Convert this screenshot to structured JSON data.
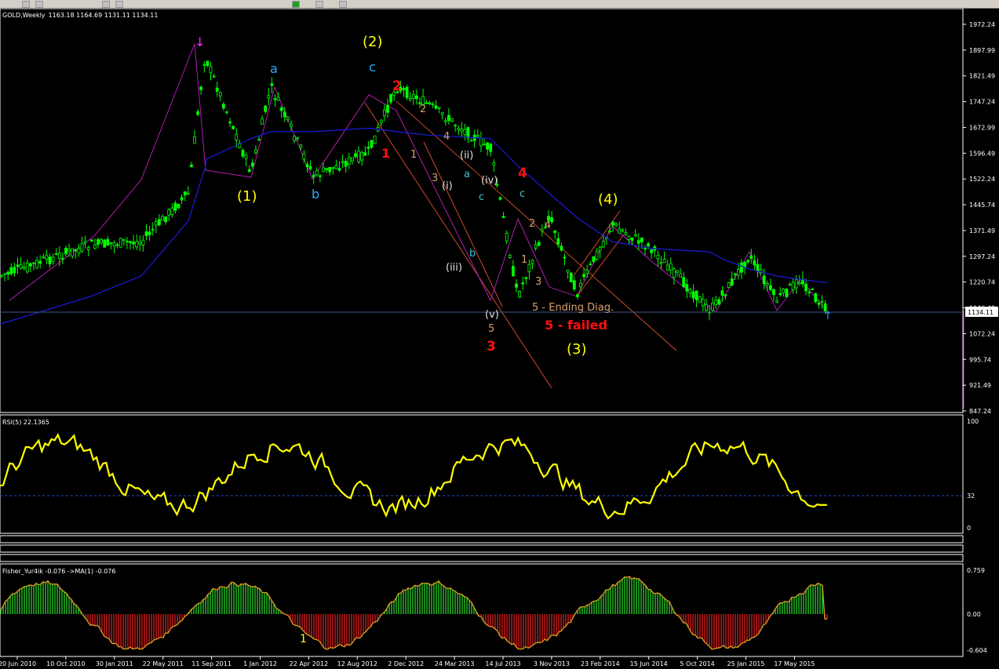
{
  "window": {
    "symbol_header": "GOLD,Weekly",
    "ohlc": "1163.18 1164.69 1131.11 1134.11"
  },
  "colors": {
    "background": "#000000",
    "candle": "#00ff00",
    "ma": "#1a1acc",
    "rsi": "#ffff00",
    "fisher_pos": "#2bd12b",
    "fisher_neg": "#e02020",
    "fisher_line": "#e0a020",
    "current_price_line": "#3b5a8a",
    "channel": "#e05030",
    "zigzag": "#c020c0",
    "wave_yellow": "#ffff00",
    "wave_cyan": "#20b0ff",
    "wave_red": "#ff1010",
    "wave_orange": "#d8a070",
    "wave_white": "#e0e0e0",
    "wave_teal": "#40c0d0"
  },
  "price_axis": {
    "labels": [
      "1972.24",
      "1897.99",
      "1821.49",
      "1747.24",
      "1672.99",
      "1596.49",
      "1522.24",
      "1445.74",
      "1371.49",
      "1297.24",
      "1220.74",
      "1146.49",
      "1072.24",
      "995.74",
      "921.49",
      "847.24"
    ],
    "current_price": "1134.11"
  },
  "rsi_panel": {
    "title": "RSI(5) 22.1365",
    "scale_top": "100",
    "level": "32",
    "scale_bottom": "0"
  },
  "fisher_panel": {
    "title": "Fisher_Yur4ik -0.076  ->MA(1) -0.076",
    "scale_top": "0.759",
    "scale_mid": "0.00",
    "scale_bottom": "-0.604"
  },
  "time_axis": {
    "labels": [
      "20 Jun 2010",
      "10 Oct 2010",
      "30 Jan 2011",
      "22 May 2011",
      "11 Sep 2011",
      "1 Jan 2012",
      "22 Apr 2012",
      "12 Aug 2012",
      "2 Dec 2012",
      "24 Mar 2013",
      "14 Jul 2013",
      "3 Nov 2013",
      "23 Feb 2014",
      "15 Jun 2014",
      "5 Oct 2014",
      "25 Jan 2015",
      "17 May 2015"
    ]
  },
  "wave_labels": {
    "w2_major": "(2)",
    "w2_c": "c",
    "a": "a",
    "w1_major": "(1)",
    "b": "b",
    "red_2": "2",
    "red_1": "1",
    "orange_2a": "2",
    "orange_1a": "1",
    "orange_3a": "3",
    "orange_4a": "4",
    "ii": "(ii)",
    "i": "(i)",
    "teal_a": "a",
    "teal_c": "c",
    "iv": "(iv)",
    "red_4": "4",
    "teal_c2": "c",
    "teal_b": "b",
    "iii": "(iii)",
    "orange_2b": "2",
    "orange_4b": "4",
    "orange_1b": "1",
    "orange_3b": "3",
    "w4_major": "(4)",
    "v": "(v)",
    "orange_5": "5",
    "red_3": "3",
    "ending_diag": "5 - Ending Diag.",
    "failed": "5 - failed",
    "w3_major": "(3)",
    "fisher_1": "1"
  },
  "chart_data": {
    "type": "line",
    "title": "GOLD,Weekly",
    "x": [
      "2010-06-20",
      "2010-10-10",
      "2011-01-30",
      "2011-05-22",
      "2011-09-04",
      "2011-09-11",
      "2011-12-25",
      "2012-02-26",
      "2012-05-13",
      "2012-08-12",
      "2012-10-07",
      "2013-01-06",
      "2013-03-24",
      "2013-06-30",
      "2013-08-25",
      "2013-12-29",
      "2014-03-16",
      "2014-06-15",
      "2014-10-05",
      "2014-11-09",
      "2015-01-25",
      "2015-04-05",
      "2015-05-17",
      "2015-07-12"
    ],
    "ylim": [
      847.24,
      1990
    ],
    "series": [
      {
        "values": [
          1240,
          1330,
          1340,
          1480,
          1900,
          1870,
          1540,
          1790,
          1530,
          1600,
          1790,
          1740,
          1610,
          1180,
          1420,
          1190,
          1390,
          1320,
          1140,
          1180,
          1300,
          1170,
          1230,
          1134.11
        ]
      },
      {
        "values": [
          1100,
          1180,
          1240,
          1400,
          1560,
          1580,
          1640,
          1660,
          1660,
          1670,
          1660,
          1650,
          1640,
          1560,
          1480,
          1410,
          1340,
          1320,
          1310,
          1290,
          1260,
          1240,
          1230,
          1220
        ]
      }
    ],
    "rsi": {
      "ylim": [
        0,
        100
      ],
      "level": 32,
      "last": 22.1365
    },
    "fisher": {
      "ylim": [
        -0.604,
        0.759
      ],
      "last": -0.076
    }
  }
}
